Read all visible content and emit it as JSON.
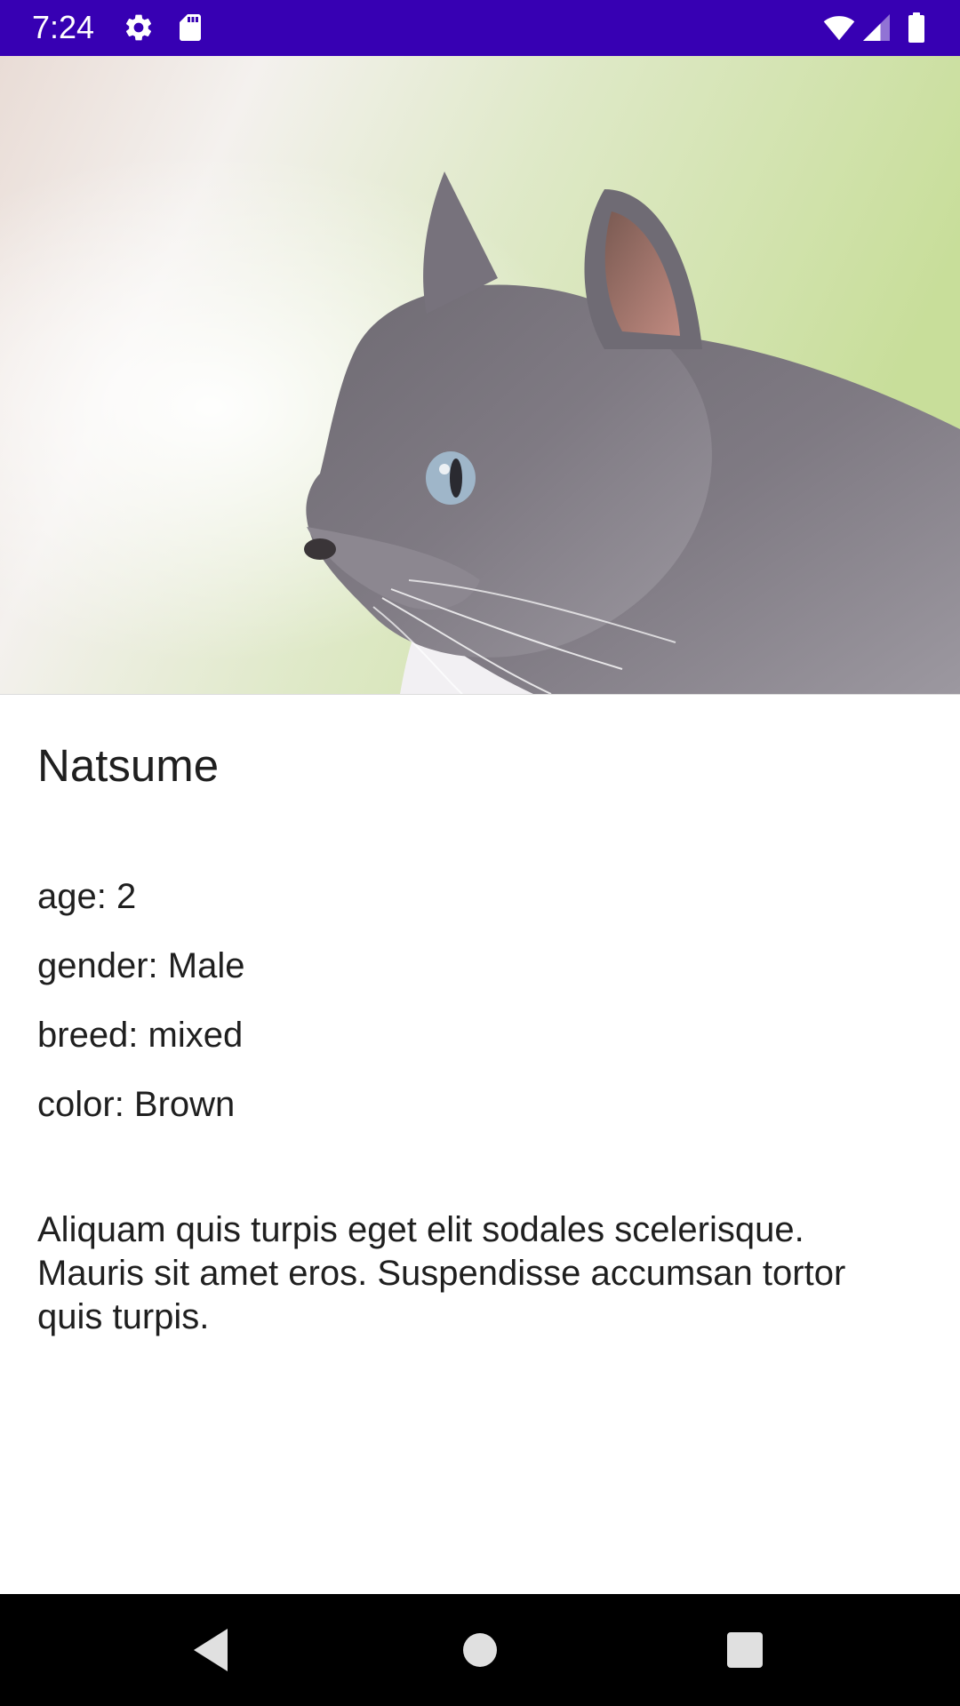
{
  "status_bar": {
    "time": "7:24",
    "background_color": "#3700b3",
    "icons_left": [
      "settings-icon",
      "sd-card-icon"
    ],
    "icons_right": [
      "wifi-icon",
      "signal-icon",
      "battery-icon"
    ]
  },
  "pet": {
    "image": "cat-photo",
    "name": "Natsume",
    "age": "age: 2",
    "gender": "gender: Male",
    "breed": "breed: mixed",
    "color": "color: Brown",
    "description": "Aliquam quis turpis eget elit sodales scelerisque. Mauris sit amet eros. Suspendisse accumsan tortor quis turpis."
  },
  "nav_bar": {
    "buttons": [
      "back-icon",
      "home-icon",
      "recents-icon"
    ]
  }
}
